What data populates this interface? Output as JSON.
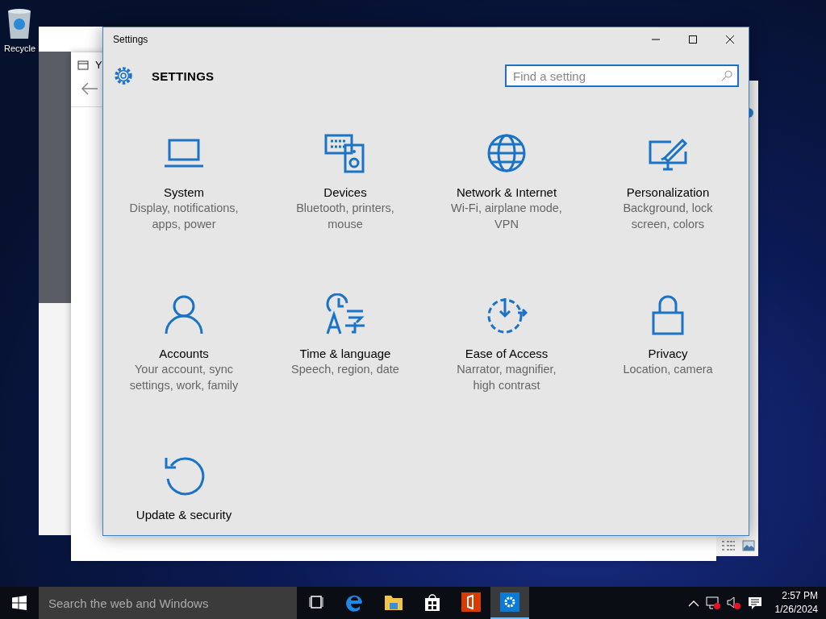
{
  "desktop": {
    "icons": [
      {
        "label": "Recycle"
      }
    ]
  },
  "background_window": {
    "title": "Y"
  },
  "window": {
    "title": "Settings",
    "heading": "SETTINGS",
    "search": {
      "placeholder": "Find a setting"
    },
    "categories": [
      {
        "kind": "system",
        "title": "System",
        "description": [
          "Display, notifications,",
          "apps, power"
        ]
      },
      {
        "kind": "devices",
        "title": "Devices",
        "description": [
          "Bluetooth, printers,",
          "mouse"
        ]
      },
      {
        "kind": "network",
        "title": "Network & Internet",
        "description": [
          "Wi-Fi, airplane mode,",
          "VPN"
        ]
      },
      {
        "kind": "personalization",
        "title": "Personalization",
        "description": [
          "Background, lock",
          "screen, colors"
        ]
      },
      {
        "kind": "accounts",
        "title": "Accounts",
        "description": [
          "Your account, sync",
          "settings, work, family"
        ]
      },
      {
        "kind": "time",
        "title": "Time & language",
        "description": [
          "Speech, region, date"
        ]
      },
      {
        "kind": "ease",
        "title": "Ease of Access",
        "description": [
          "Narrator, magnifier,",
          "high contrast"
        ]
      },
      {
        "kind": "privacy",
        "title": "Privacy",
        "description": [
          "Location, camera"
        ]
      },
      {
        "kind": "update",
        "title": "Update & security"
      }
    ]
  },
  "taskbar": {
    "search": {
      "placeholder": "Search the web and Windows"
    },
    "apps": [
      {
        "kind": "taskview",
        "selected": false
      },
      {
        "kind": "edge",
        "selected": false
      },
      {
        "kind": "explorer",
        "selected": false
      },
      {
        "kind": "store",
        "selected": false
      },
      {
        "kind": "office",
        "selected": false
      },
      {
        "kind": "settings",
        "selected": true
      }
    ],
    "clock": {
      "time": "2:57 PM",
      "date": "1/26/2024"
    }
  }
}
